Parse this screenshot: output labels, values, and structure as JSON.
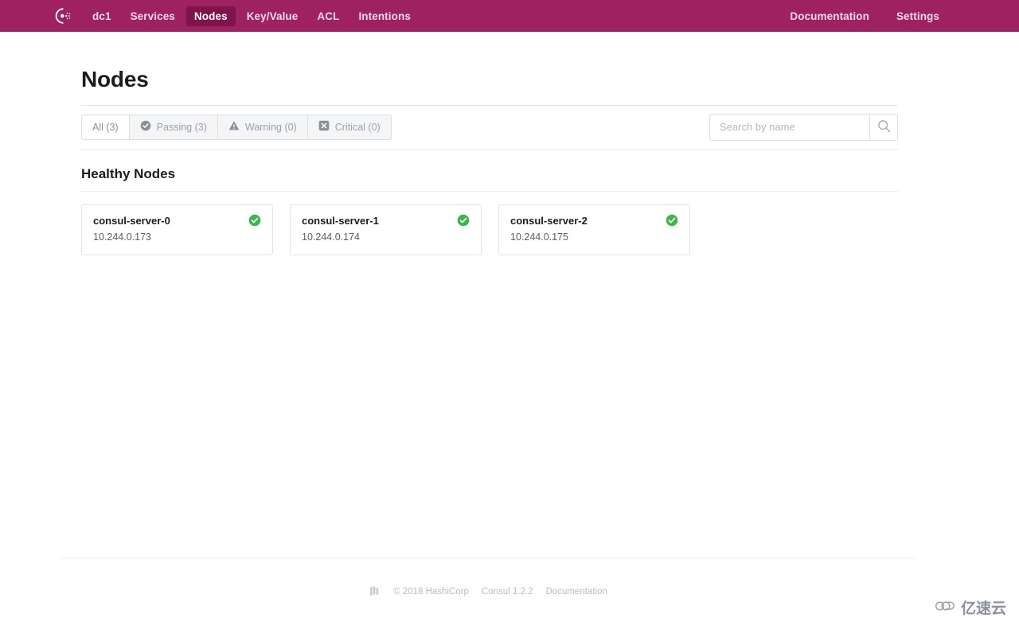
{
  "navbar": {
    "logo_icon": "consul-logo-icon",
    "brand_color": "#9e2162",
    "active_color": "#7e1449",
    "left_items": [
      {
        "label": "dc1",
        "name": "datacenter",
        "active": false
      },
      {
        "label": "Services",
        "name": "services",
        "active": false
      },
      {
        "label": "Nodes",
        "name": "nodes",
        "active": true
      },
      {
        "label": "Key/Value",
        "name": "key-value",
        "active": false
      },
      {
        "label": "ACL",
        "name": "acl",
        "active": false
      },
      {
        "label": "Intentions",
        "name": "intentions",
        "active": false
      }
    ],
    "right_items": [
      {
        "label": "Documentation",
        "name": "documentation"
      },
      {
        "label": "Settings",
        "name": "settings"
      }
    ]
  },
  "main": {
    "title": "Nodes",
    "filters": [
      {
        "label": "All (3)",
        "name": "all",
        "icon": "none",
        "selected": true
      },
      {
        "label": "Passing (3)",
        "name": "passing",
        "icon": "check-circle-icon",
        "selected": false
      },
      {
        "label": "Warning (0)",
        "name": "warning",
        "icon": "warning-triangle-icon",
        "selected": false
      },
      {
        "label": "Critical (0)",
        "name": "critical",
        "icon": "x-square-icon",
        "selected": false
      }
    ],
    "search": {
      "placeholder": "Search by name",
      "value": "",
      "icon": "search-icon"
    },
    "section_title": "Healthy Nodes",
    "status_color": "#3cb54a",
    "nodes": [
      {
        "name": "consul-server-0",
        "address": "10.244.0.173",
        "status": "passing",
        "status_icon": "check-circle-icon"
      },
      {
        "name": "consul-server-1",
        "address": "10.244.0.174",
        "status": "passing",
        "status_icon": "check-circle-icon"
      },
      {
        "name": "consul-server-2",
        "address": "10.244.0.175",
        "status": "passing",
        "status_icon": "check-circle-icon"
      }
    ]
  },
  "footer": {
    "logo_icon": "hashicorp-logo-icon",
    "copyright": "© 2018 HashiCorp",
    "version": "Consul 1.2.2",
    "documentation": "Documentation"
  },
  "watermark": {
    "icon": "cloud-icon",
    "text": "亿速云"
  }
}
